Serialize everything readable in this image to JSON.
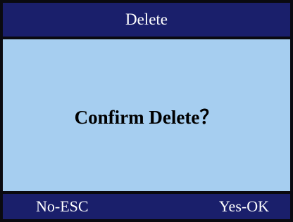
{
  "dialog": {
    "title": "Delete",
    "message": "Confirm Delete？"
  },
  "softkeys": {
    "left_label": "No-ESC",
    "right_label": "Yes-OK"
  },
  "colors": {
    "bar_background": "#1a1f6b",
    "content_background": "#a6cef0",
    "border": "#0a0a10",
    "bar_text": "#ffffff",
    "message_text": "#000000"
  }
}
